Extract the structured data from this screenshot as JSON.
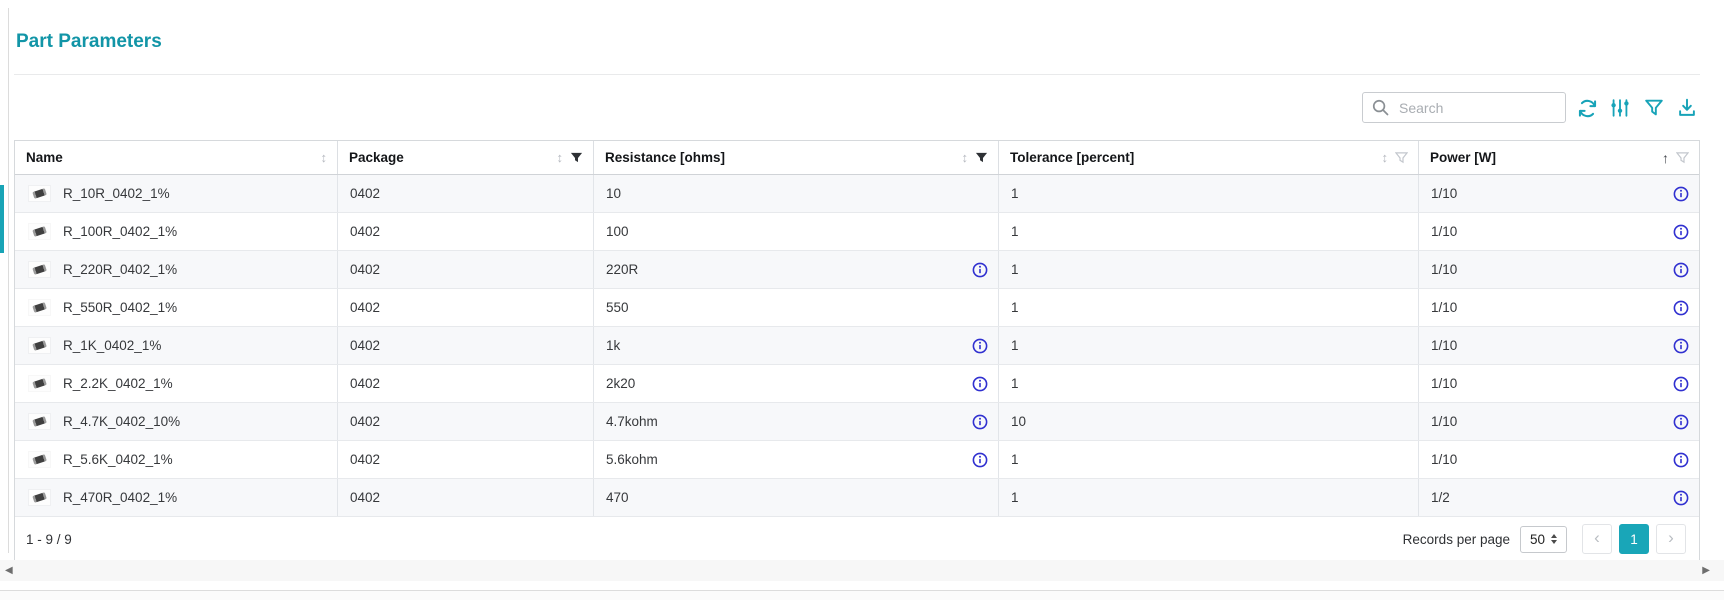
{
  "title": "Part Parameters",
  "colors": {
    "accent_teal": "#1295a7",
    "toolbar_icon_teal": "#17a3b8",
    "info_icon_blue": "#3030d0",
    "active_page_bg": "#19a6b8"
  },
  "toolbar": {
    "search_placeholder": "Search",
    "search_icon": "magnifier-icon",
    "buttons": [
      {
        "name": "refresh",
        "icon": "refresh-icon"
      },
      {
        "name": "column-settings",
        "icon": "sliders-icon"
      },
      {
        "name": "filter",
        "icon": "funnel-icon"
      },
      {
        "name": "export",
        "icon": "download-icon"
      }
    ]
  },
  "table": {
    "columns": [
      {
        "label": "Name",
        "sort_glyph": "↕",
        "sort_state": "unsorted",
        "filter_state": "none"
      },
      {
        "label": "Package",
        "sort_glyph": "↕",
        "sort_state": "unsorted",
        "filter_state": "active"
      },
      {
        "label": "Resistance [ohms]",
        "sort_glyph": "↕",
        "sort_state": "unsorted",
        "filter_state": "active"
      },
      {
        "label": "Tolerance [percent]",
        "sort_glyph": "↕",
        "sort_state": "unsorted",
        "filter_state": "available"
      },
      {
        "label": "Power [W]",
        "sort_glyph": "↑",
        "sort_state": "ascending",
        "filter_state": "available"
      }
    ],
    "rows": [
      {
        "name": "R_10R_0402_1%",
        "package": "0402",
        "resistance": "10",
        "tolerance": "1",
        "power": "1/10",
        "resistance_info": false,
        "power_info": true
      },
      {
        "name": "R_100R_0402_1%",
        "package": "0402",
        "resistance": "100",
        "tolerance": "1",
        "power": "1/10",
        "resistance_info": false,
        "power_info": true
      },
      {
        "name": "R_220R_0402_1%",
        "package": "0402",
        "resistance": "220R",
        "tolerance": "1",
        "power": "1/10",
        "resistance_info": true,
        "power_info": true
      },
      {
        "name": "R_550R_0402_1%",
        "package": "0402",
        "resistance": "550",
        "tolerance": "1",
        "power": "1/10",
        "resistance_info": false,
        "power_info": true
      },
      {
        "name": "R_1K_0402_1%",
        "package": "0402",
        "resistance": "1k",
        "tolerance": "1",
        "power": "1/10",
        "resistance_info": true,
        "power_info": true
      },
      {
        "name": "R_2.2K_0402_1%",
        "package": "0402",
        "resistance": "2k20",
        "tolerance": "1",
        "power": "1/10",
        "resistance_info": true,
        "power_info": true
      },
      {
        "name": "R_4.7K_0402_10%",
        "package": "0402",
        "resistance": "4.7kohm",
        "tolerance": "10",
        "power": "1/10",
        "resistance_info": true,
        "power_info": true
      },
      {
        "name": "R_5.6K_0402_1%",
        "package": "0402",
        "resistance": "5.6kohm",
        "tolerance": "1",
        "power": "1/10",
        "resistance_info": true,
        "power_info": true
      },
      {
        "name": "R_470R_0402_1%",
        "package": "0402",
        "resistance": "470",
        "tolerance": "1",
        "power": "1/2",
        "resistance_info": false,
        "power_info": true
      }
    ]
  },
  "footer": {
    "range": "1 - 9 / 9",
    "records_per_page_label": "Records per page",
    "records_per_page_value": "50",
    "pagination": {
      "prev_glyph": "‹",
      "current_page": "1",
      "next_glyph": "›"
    }
  },
  "scrollbar": {
    "left_glyph": "◀",
    "right_glyph": "▶"
  }
}
